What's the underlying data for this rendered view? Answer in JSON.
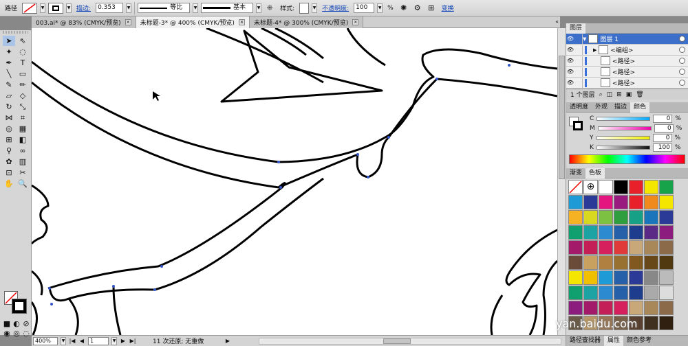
{
  "controlbar": {
    "object_type": "路径",
    "stroke_label": "描边:",
    "stroke_value": "0.353",
    "profile_label": "等比",
    "brush_label": "基本",
    "style_label": "样式:",
    "opacity_label": "不透明度:",
    "opacity_value": "100",
    "opacity_unit": "%",
    "transform_label": "变换"
  },
  "tabs": [
    {
      "label": "003.ai* @ 83% (CMYK/预览)"
    },
    {
      "label": "未标题-3* @ 400% (CMYK/预览)"
    },
    {
      "label": "未标题-4* @ 300% (CMYK/预览)"
    }
  ],
  "status": {
    "zoom": "400%",
    "page": "1",
    "message": "11 次还原; 无重做"
  },
  "layers": {
    "tab": "图层",
    "rows": [
      {
        "name": "图层 1"
      },
      {
        "name": "<编组>"
      },
      {
        "name": "<路径>"
      },
      {
        "name": "<路径>"
      },
      {
        "name": "<路径>"
      }
    ],
    "footer": "1 个图层"
  },
  "color_panel": {
    "tabs": [
      "透明度",
      "外观",
      "描边",
      "颜色"
    ],
    "channels": [
      {
        "name": "C",
        "value": "0"
      },
      {
        "name": "M",
        "value": "0"
      },
      {
        "name": "Y",
        "value": "0"
      },
      {
        "name": "K",
        "value": "100"
      }
    ],
    "unit": "%"
  },
  "swatches_panel": {
    "tabs": [
      "渐变",
      "色板"
    ]
  },
  "bottom_tabs": [
    "路径查找器",
    "属性",
    "颜色参考"
  ],
  "watermark": "yan.baidu.com",
  "swatch_colors": [
    "#ffffff",
    "#ffffff",
    "#ffffff",
    "#000000",
    "#e8202a",
    "#f5e600",
    "#17a34a",
    "#1e9ad6",
    "#2b3a97",
    "#e4157f",
    "#9a1b7f",
    "#e8202a",
    "#f08a1c",
    "#f5e600",
    "#f5b324",
    "#d8d820",
    "#7cc142",
    "#2e9e3e",
    "#16a085",
    "#1a75bb",
    "#2b3a97",
    "#10a070",
    "#1ea3a5",
    "#2b8ad0",
    "#2560a8",
    "#1e3d8c",
    "#5b2a86",
    "#8c1d7e",
    "#a31a6b",
    "#c41f56",
    "#d6205e",
    "#e03a3a",
    "#c8a878",
    "#a88858",
    "#8a6a48",
    "#6a4a38",
    "#c8a060",
    "#b08040",
    "#987030",
    "#805820",
    "#684818",
    "#503810",
    "#f5e600",
    "#f0c000",
    "#1e9ad6",
    "#2560a8",
    "#2b3a97",
    "#888888",
    "#bbbbbb",
    "#10a070",
    "#1ea3a5",
    "#2b8ad0",
    "#2560a8",
    "#1e3d8c",
    "#aaaaaa",
    "#dddddd",
    "#8c1d7e",
    "#a31a6b",
    "#c41f56",
    "#d6205e",
    "#c8a878",
    "#a88858",
    "#8a6a48",
    "#6a5a48",
    "#b89868",
    "#987858",
    "#786048",
    "#584030",
    "#403020",
    "#302010"
  ]
}
